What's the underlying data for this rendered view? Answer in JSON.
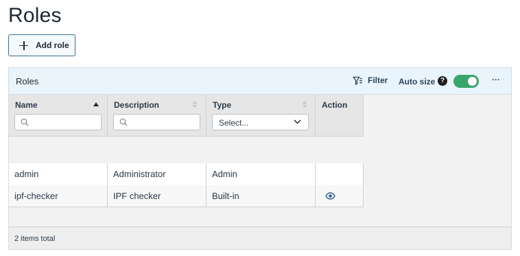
{
  "page": {
    "title": "Roles",
    "add_button_label": "Add role"
  },
  "panel": {
    "title": "Roles",
    "toolbar": {
      "filter_label": "Filter",
      "autosize_label": "Auto size",
      "help_glyph": "?",
      "autosize_enabled": true,
      "more_label": "···"
    }
  },
  "table": {
    "columns": [
      {
        "label": "Name",
        "sort": "ascending",
        "filter": "search",
        "value": ""
      },
      {
        "label": "Description",
        "sort": "none",
        "filter": "search",
        "value": ""
      },
      {
        "label": "Type",
        "sort": "none",
        "filter": "select",
        "value": "Select..."
      },
      {
        "label": "Action",
        "sort": "none",
        "filter": "none"
      }
    ],
    "rows": [
      {
        "name": "admin",
        "description": "Administrator",
        "type": "Admin",
        "action": ""
      },
      {
        "name": "ipf-checker",
        "description": "IPF checker",
        "type": "Built-in",
        "action": "eye-icon"
      }
    ]
  },
  "footer": {
    "total_text": "2 items total"
  },
  "colors": {
    "accent": "#3b6e8f",
    "toggle_on": "#3aa56a",
    "header_bg": "#eaf4fc",
    "icon_blue": "#2e5e8c"
  }
}
